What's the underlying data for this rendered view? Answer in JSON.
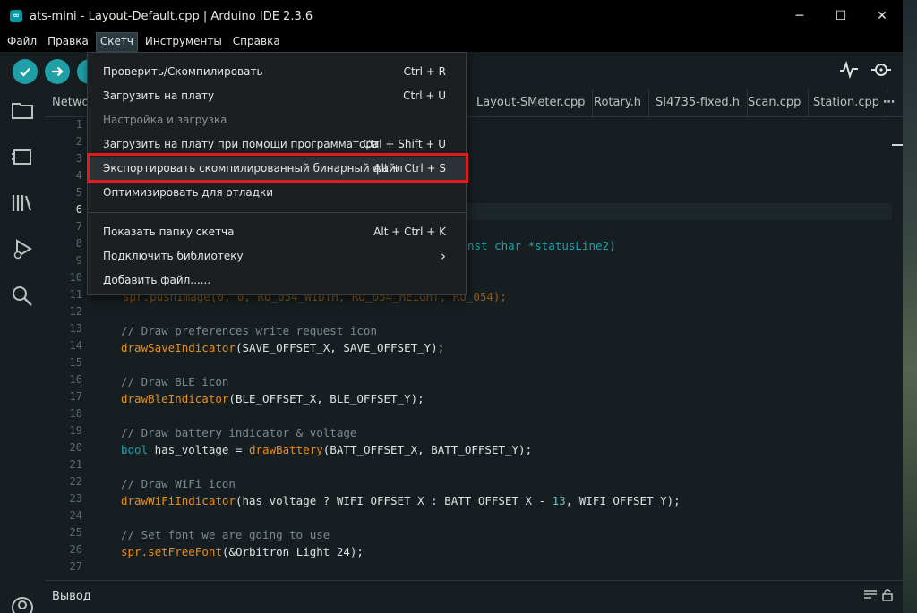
{
  "window": {
    "title": "ats-mini - Layout-Default.cpp | Arduino IDE 2.3.6",
    "controls": [
      "─",
      "☐",
      "✕"
    ]
  },
  "menubar": {
    "items": [
      "Файл",
      "Правка",
      "Скетч",
      "Инструменты",
      "Справка"
    ],
    "active": "Скетч"
  },
  "toolbar": {
    "verify_icon": "check-icon",
    "upload_icon": "arrow-right-icon",
    "debug_icon": "debug-icon",
    "serial_plotter_icon": "plotter-icon",
    "serial_monitor_icon": "monitor-icon"
  },
  "tabs": {
    "items": [
      "Netwo",
      "Layout-SMeter.cpp",
      "Rotary.h",
      "SI4735-fixed.h",
      "Scan.cpp",
      "Station.cpp"
    ],
    "more": "⋯"
  },
  "editor": {
    "line_numbers": [
      "1",
      "2",
      "3",
      "4",
      "5",
      "6",
      "7",
      "8",
      "9",
      "10",
      "11",
      "12",
      "13",
      "14",
      "15",
      "16",
      "17",
      "18",
      "19",
      "20",
      "21",
      "22",
      "23",
      "24",
      "25",
      "26",
      "27"
    ],
    "current_line": "6",
    "code": {
      "l8_tail": "nst char *statusLine2)",
      "l10_tail": "spr.pushImage(0, 0, RU_054_WIDTH, RU_054_HEIGHT, RU_054);",
      "l13": "// Draw preferences write request icon",
      "l14_fn": "drawSaveIndicator",
      "l14_args": "(SAVE_OFFSET_X, SAVE_OFFSET_Y);",
      "l16": "// Draw BLE icon",
      "l17_fn": "drawBleIndicator",
      "l17_args": "(BLE_OFFSET_X, BLE_OFFSET_Y);",
      "l19": "// Draw battery indicator & voltage",
      "l20_kw": "bool",
      "l20_mid": " has_voltage = ",
      "l20_fn": "drawBattery",
      "l20_args": "(BATT_OFFSET_X, BATT_OFFSET_Y);",
      "l22": "// Draw WiFi icon",
      "l23_fn": "drawWiFiIndicator",
      "l23_args_a": "(has_voltage ? WIFI_OFFSET_X : BATT_OFFSET_X - ",
      "l23_num": "13",
      "l23_args_b": ", WIFI_OFFSET_Y);",
      "l25": "// Set font we are going to use",
      "l26_obj": "spr.",
      "l26_fn": "setFreeFont",
      "l26_args": "(&Orbitron_Light_24);"
    }
  },
  "output": {
    "label": "Вывод"
  },
  "sketch_menu": {
    "items": [
      {
        "label": "Проверить/Скомпилировать",
        "shortcut": "Ctrl + R"
      },
      {
        "label": "Загрузить на плату",
        "shortcut": "Ctrl + U"
      },
      {
        "label": "Настройка и загрузка",
        "shortcut": ""
      },
      {
        "label": "Загрузить на плату при помощи программатора",
        "shortcut": "Ctrl + Shift + U"
      },
      {
        "label": "Экспортировать скомпилированный бинарный файл",
        "shortcut": "Alt + Ctrl + S"
      },
      {
        "label": "Оптимизировать для отладки",
        "shortcut": ""
      },
      {
        "label": "Показать папку скетча",
        "shortcut": "Alt + Ctrl + K"
      },
      {
        "label": "Подключить библиотеку",
        "shortcut": "›"
      },
      {
        "label": "Добавить файл......",
        "shortcut": ""
      }
    ],
    "highlight_color": "#e11b1b"
  }
}
